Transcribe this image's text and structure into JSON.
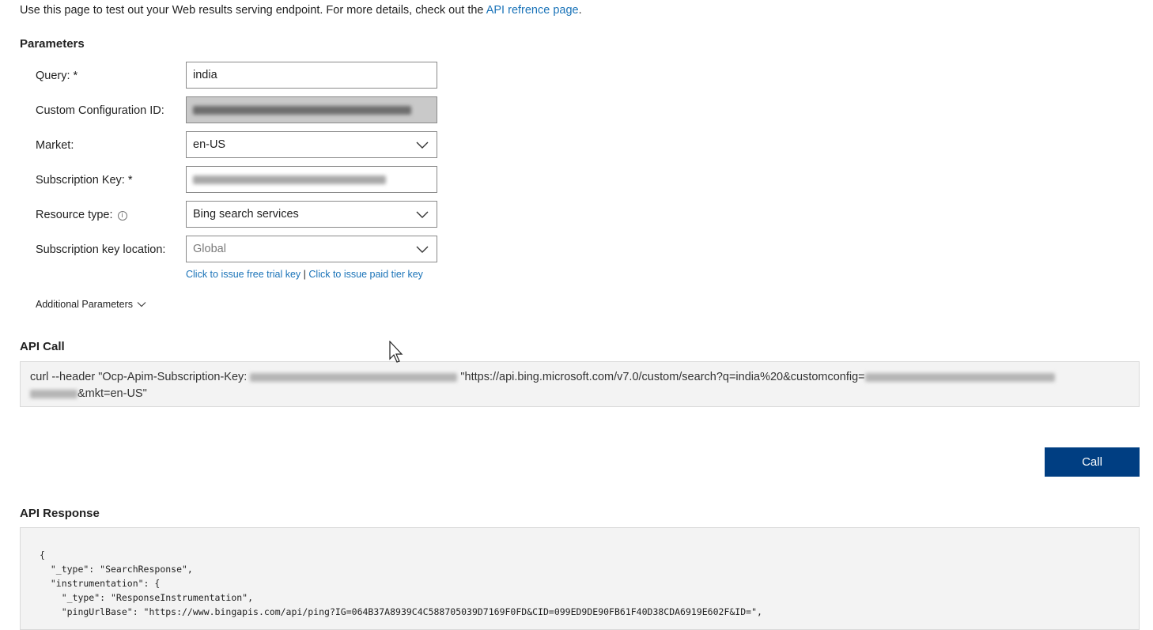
{
  "intro": {
    "text": "Use this page to test out your Web results serving endpoint. For more details, check out the ",
    "link": "API refrence page",
    "suffix": "."
  },
  "parameters": {
    "title": "Parameters",
    "query": {
      "label": "Query: *",
      "value": "india"
    },
    "custom_config": {
      "label": "Custom Configuration ID:"
    },
    "market": {
      "label": "Market:",
      "value": "en-US"
    },
    "subscription_key": {
      "label": "Subscription Key: *"
    },
    "resource_type": {
      "label": "Resource type:",
      "value": "Bing search services"
    },
    "key_location": {
      "label": "Subscription key location:",
      "value": "Global"
    },
    "free_trial_link": "Click to issue free trial key",
    "separator": "|",
    "paid_tier_link": "Click to issue paid tier key",
    "additional": "Additional Parameters"
  },
  "api_call": {
    "title": "API Call",
    "part1": "curl --header \"Ocp-Apim-Subscription-Key: ",
    "part2": " \"https://api.bing.microsoft.com/v7.0/custom/search?q=india%20&customconfig=",
    "part3": "&mkt=en-US\""
  },
  "call_button": "Call",
  "api_response": {
    "title": "API Response",
    "body": "{\n  \"_type\": \"SearchResponse\",\n  \"instrumentation\": {\n    \"_type\": \"ResponseInstrumentation\",\n    \"pingUrlBase\": \"https://www.bingapis.com/api/ping?IG=064B37A8939C4C588705039D7169F0FD&CID=099ED9DE90FB61F40D38CDA6919E602F&ID=\","
  },
  "colors": {
    "link": "#1a73b8",
    "button": "#003e82",
    "panel": "#f3f3f3"
  }
}
